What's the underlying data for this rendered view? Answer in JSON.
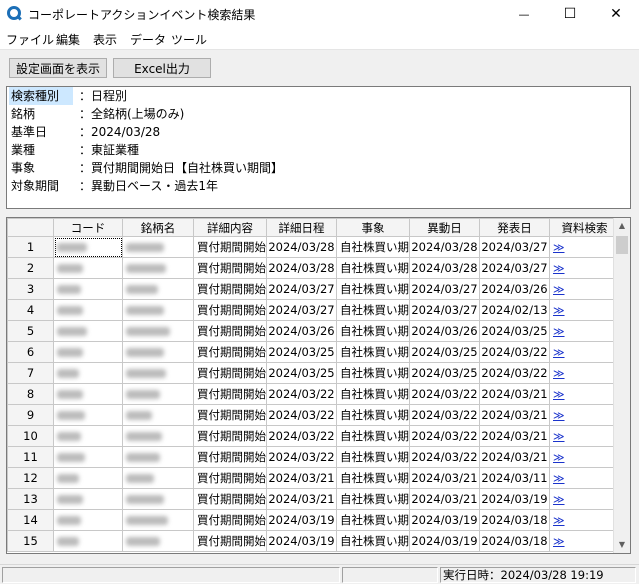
{
  "window": {
    "title": "コーポレートアクションイベント検索結果",
    "min_glyph": "—",
    "max_glyph": "☐",
    "close_glyph": "✕"
  },
  "menu": [
    "ファイル",
    "編集",
    "表示",
    "データ",
    "ツール"
  ],
  "toolbar": {
    "show_settings_label": "設定画面を表示",
    "excel_label": "Excel出力"
  },
  "info": [
    {
      "label": "検索種別",
      "value": "：日程別"
    },
    {
      "label": "銘柄",
      "value": "：全銘柄(上場のみ)"
    },
    {
      "label": "基準日",
      "value": "：2024/03/28"
    },
    {
      "label": "業種",
      "value": "：東証業種"
    },
    {
      "label": "事象",
      "value": "：買付期間開始日【自社株買い期間】"
    },
    {
      "label": "対象期間",
      "value": "：異動日ベース・過去1年"
    }
  ],
  "table": {
    "headers": [
      "",
      "コード",
      "銘柄名",
      "詳細内容",
      "詳細日程",
      "事象",
      "異動日",
      "発表日",
      "資料検索"
    ],
    "link_glyph": "≫",
    "rows": [
      {
        "num": "1",
        "detail": "買付期間開始",
        "detail_date": "2024/03/28",
        "event": "自社株買い期",
        "move_date": "2024/03/28",
        "ann_date": "2024/03/27"
      },
      {
        "num": "2",
        "detail": "買付期間開始",
        "detail_date": "2024/03/28",
        "event": "自社株買い期",
        "move_date": "2024/03/28",
        "ann_date": "2024/03/27"
      },
      {
        "num": "3",
        "detail": "買付期間開始",
        "detail_date": "2024/03/27",
        "event": "自社株買い期",
        "move_date": "2024/03/27",
        "ann_date": "2024/03/26"
      },
      {
        "num": "4",
        "detail": "買付期間開始",
        "detail_date": "2024/03/27",
        "event": "自社株買い期",
        "move_date": "2024/03/27",
        "ann_date": "2024/02/13"
      },
      {
        "num": "5",
        "detail": "買付期間開始",
        "detail_date": "2024/03/26",
        "event": "自社株買い期",
        "move_date": "2024/03/26",
        "ann_date": "2024/03/25"
      },
      {
        "num": "6",
        "detail": "買付期間開始",
        "detail_date": "2024/03/25",
        "event": "自社株買い期",
        "move_date": "2024/03/25",
        "ann_date": "2024/03/22"
      },
      {
        "num": "7",
        "detail": "買付期間開始",
        "detail_date": "2024/03/25",
        "event": "自社株買い期",
        "move_date": "2024/03/25",
        "ann_date": "2024/03/22"
      },
      {
        "num": "8",
        "detail": "買付期間開始",
        "detail_date": "2024/03/22",
        "event": "自社株買い期",
        "move_date": "2024/03/22",
        "ann_date": "2024/03/21"
      },
      {
        "num": "9",
        "detail": "買付期間開始",
        "detail_date": "2024/03/22",
        "event": "自社株買い期",
        "move_date": "2024/03/22",
        "ann_date": "2024/03/21"
      },
      {
        "num": "10",
        "detail": "買付期間開始",
        "detail_date": "2024/03/22",
        "event": "自社株買い期",
        "move_date": "2024/03/22",
        "ann_date": "2024/03/21"
      },
      {
        "num": "11",
        "detail": "買付期間開始",
        "detail_date": "2024/03/22",
        "event": "自社株買い期",
        "move_date": "2024/03/22",
        "ann_date": "2024/03/21"
      },
      {
        "num": "12",
        "detail": "買付期間開始",
        "detail_date": "2024/03/21",
        "event": "自社株買い期",
        "move_date": "2024/03/21",
        "ann_date": "2024/03/11"
      },
      {
        "num": "13",
        "detail": "買付期間開始",
        "detail_date": "2024/03/21",
        "event": "自社株買い期",
        "move_date": "2024/03/21",
        "ann_date": "2024/03/19"
      },
      {
        "num": "14",
        "detail": "買付期間開始",
        "detail_date": "2024/03/19",
        "event": "自社株買い期",
        "move_date": "2024/03/19",
        "ann_date": "2024/03/18"
      },
      {
        "num": "15",
        "detail": "買付期間開始",
        "detail_date": "2024/03/19",
        "event": "自社株買い期",
        "move_date": "2024/03/19",
        "ann_date": "2024/03/18"
      }
    ]
  },
  "status": {
    "executed": "実行日時：2024/03/28 19:19"
  },
  "colors": {
    "link": "#1a33cc",
    "selection": "#cde8ff",
    "app_icon": "#1c6fb7"
  }
}
